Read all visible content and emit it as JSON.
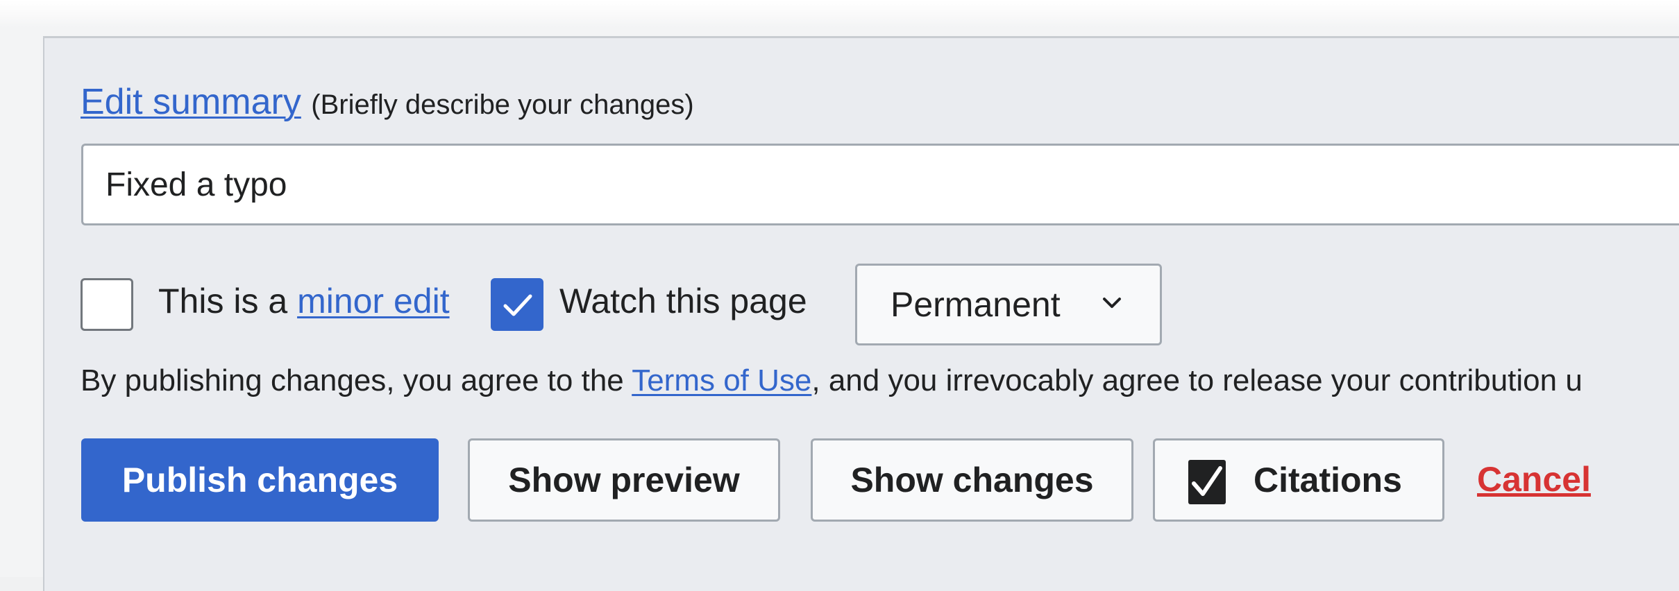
{
  "summary": {
    "link_label": "Edit summary",
    "hint": "(Briefly describe your changes)",
    "value": "Fixed a typo"
  },
  "options": {
    "minor_edit": {
      "checked": false,
      "label_prefix": "This is a ",
      "label_link": "minor edit"
    },
    "watch": {
      "checked": true,
      "label": "Watch this page"
    },
    "watch_period": {
      "selected": "Permanent"
    }
  },
  "legal": {
    "prefix": "By publishing changes, you agree to the ",
    "terms_link": "Terms of Use",
    "suffix": ", and you irrevocably agree to release your contribution u"
  },
  "buttons": {
    "publish": "Publish changes",
    "preview": "Show preview",
    "changes": "Show changes",
    "citations": "Citations",
    "cancel": "Cancel"
  },
  "icons": {
    "checkbox_check": "checkmark-icon",
    "dropdown": "chevron-down-icon",
    "citations": "citation-check-icon"
  },
  "colors": {
    "accent": "#3366cc",
    "destructive": "#d73333",
    "panel_bg": "#eaecf0",
    "border": "#a2a9b1"
  }
}
